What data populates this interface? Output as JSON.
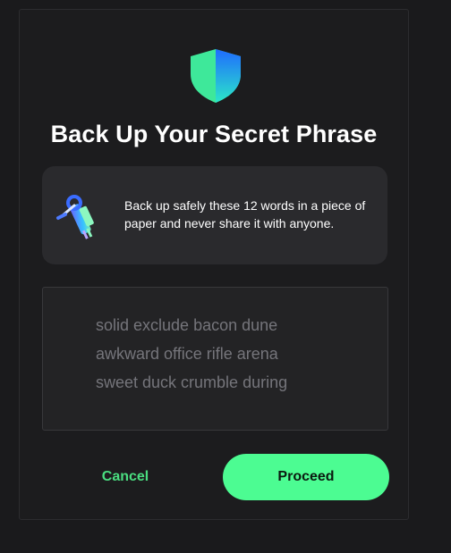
{
  "dialog": {
    "title": "Back Up Your Secret Phrase",
    "info_text": "Back up safely these 12 words in a piece of paper and never share it with anyone.",
    "phrase_lines": [
      "solid exclude bacon dune",
      "awkward office rifle arena",
      "sweet duck crumble during"
    ],
    "cancel_label": "Cancel",
    "proceed_label": "Proceed"
  },
  "icons": {
    "header": "shield-icon",
    "info": "key-icon"
  },
  "colors": {
    "accent": "#4cfc92",
    "accent_text": "#4ade80",
    "shield_green": "#3ee89a",
    "shield_blue": "#1f6bff"
  }
}
